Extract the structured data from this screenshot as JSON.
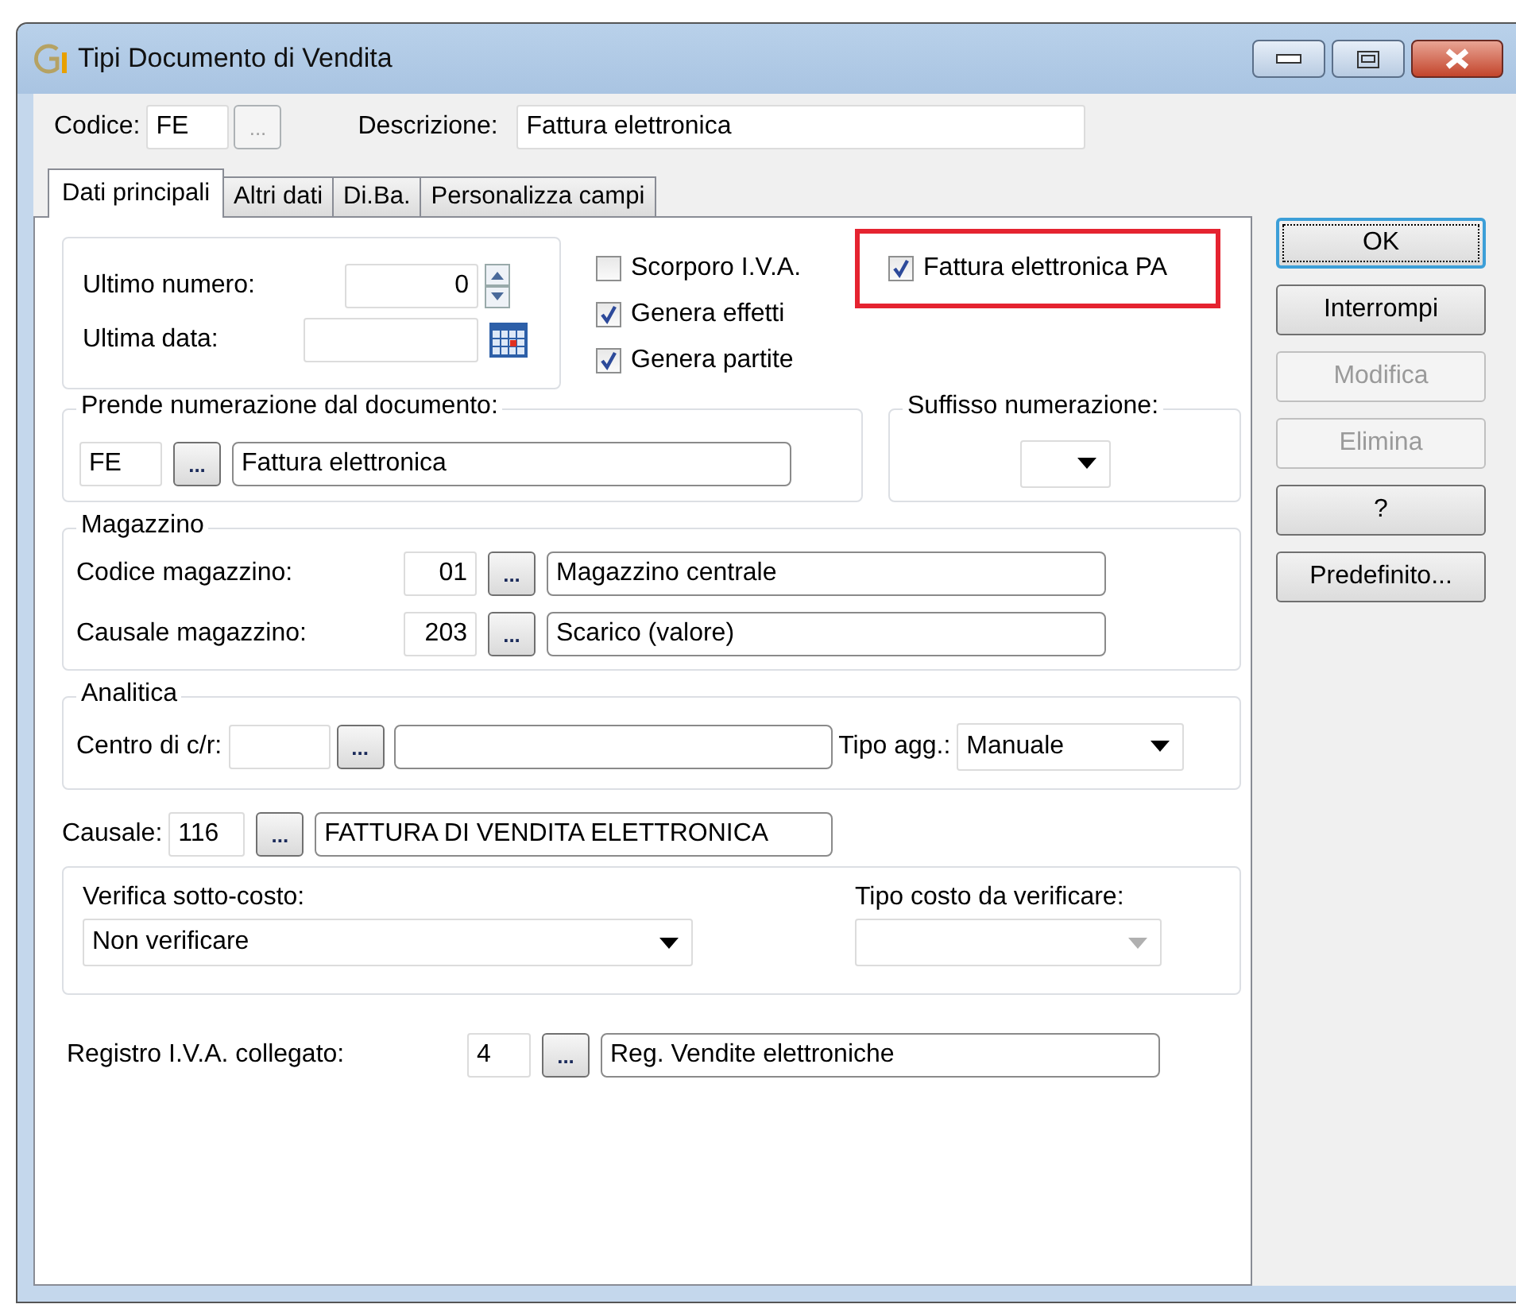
{
  "window": {
    "title": "Tipi Documento di Vendita"
  },
  "header": {
    "codice_label": "Codice:",
    "codice_value": "FE",
    "browse": "...",
    "browse_disabled": true,
    "descrizione_label": "Descrizione:",
    "descrizione_value": "Fattura elettronica"
  },
  "tabs": [
    {
      "label": "Dati principali",
      "selected": true
    },
    {
      "label": "Altri dati",
      "selected": false
    },
    {
      "label": "Di.Ba.",
      "selected": false
    },
    {
      "label": "Personalizza campi",
      "selected": false
    }
  ],
  "numbering": {
    "ultimo_numero_label": "Ultimo numero:",
    "ultimo_numero": "0",
    "ultima_data_label": "Ultima data:"
  },
  "checkboxes": [
    {
      "label": "Scorporo I.V.A.",
      "checked": false
    },
    {
      "label": "Genera effetti",
      "checked": true
    },
    {
      "label": "Genera partite",
      "checked": true
    }
  ],
  "pa_checkbox": {
    "label": "Fattura elettronica PA",
    "checked": true,
    "highlighted": true
  },
  "numerazione": {
    "title": "Prende numerazione dal documento:",
    "code": "FE",
    "browse": "...",
    "description": "Fattura elettronica"
  },
  "suffisso": {
    "title": "Suffisso numerazione:"
  },
  "magazzino": {
    "title": "Magazzino",
    "rows": [
      {
        "label": "Codice magazzino:",
        "code": "01",
        "browse": "...",
        "description": "Magazzino centrale"
      },
      {
        "label": "Causale magazzino:",
        "code": "203",
        "browse": "...",
        "description": "Scarico (valore)"
      }
    ]
  },
  "analitica": {
    "title": "Analitica",
    "centro_label": "Centro di c/r:",
    "browse": "...",
    "tipo_label": "Tipo agg.:",
    "tipo_value": "Manuale"
  },
  "causale": {
    "label": "Causale:",
    "code": "116",
    "browse": "...",
    "description": "FATTURA DI VENDITA ELETTRONICA"
  },
  "verifica": {
    "label": "Verifica sotto-costo:",
    "value": "Non verificare",
    "tipo_label": "Tipo costo da verificare:",
    "tipo_disabled": true
  },
  "registro": {
    "label": "Registro I.V.A. collegato:",
    "code": "4",
    "browse": "...",
    "description": "Reg. Vendite elettroniche"
  },
  "buttons": [
    {
      "label": "OK",
      "default": true,
      "disabled": false
    },
    {
      "label": "Interrompi",
      "default": false,
      "disabled": false
    },
    {
      "label": "Modifica",
      "default": false,
      "disabled": true
    },
    {
      "label": "Elimina",
      "default": false,
      "disabled": true
    },
    {
      "label": "?",
      "default": false,
      "disabled": false
    },
    {
      "label": "Predefinito...",
      "default": false,
      "disabled": false
    }
  ]
}
